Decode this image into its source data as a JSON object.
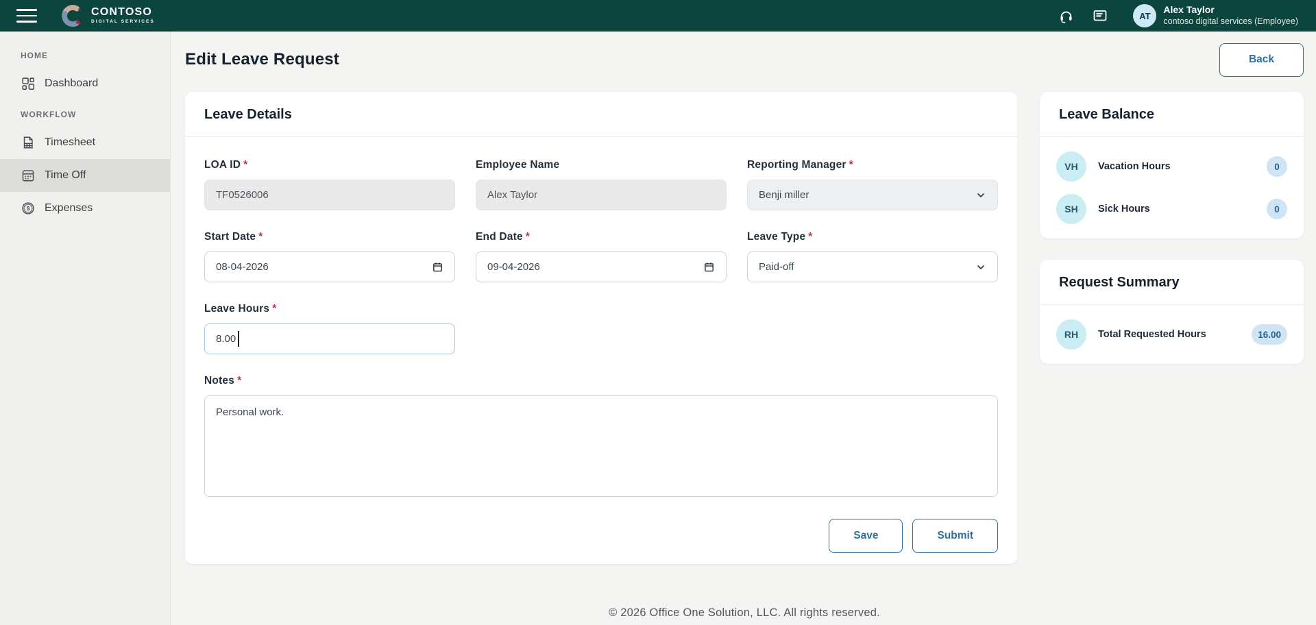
{
  "ui": {
    "required_marker": "*"
  },
  "colors": {
    "header_bg": "#0b453e",
    "accent_blue": "#2e6f9f",
    "required_red": "#b8304a",
    "badge_bg": "#cfe4f4",
    "badge_text": "#28648e",
    "avatar_cyan_bg": "#c9edf3",
    "sidebar_active_bg": "#dcdcda"
  },
  "header": {
    "brand": {
      "name": "CONTOSO",
      "tagline": "DIGITAL SERVICES"
    },
    "user": {
      "initials": "AT",
      "name": "Alex Taylor",
      "org_role": "contoso digital services (Employee)"
    }
  },
  "sidebar": {
    "sections": [
      {
        "label": "HOME",
        "items": [
          {
            "label": "Dashboard"
          }
        ]
      },
      {
        "label": "WORKFLOW",
        "items": [
          {
            "label": "Timesheet"
          },
          {
            "label": "Time Off"
          },
          {
            "label": "Expenses"
          }
        ]
      }
    ]
  },
  "page": {
    "title": "Edit Leave Request",
    "back_label": "Back"
  },
  "form": {
    "section_title": "Leave Details",
    "loa_id": {
      "label": "LOA ID",
      "value": "TF0526006"
    },
    "employee_name": {
      "label": "Employee Name",
      "value": "Alex Taylor"
    },
    "reporting_manager": {
      "label": "Reporting Manager",
      "value": "Benji miller"
    },
    "start_date": {
      "label": "Start Date",
      "value": "08-04-2026"
    },
    "end_date": {
      "label": "End Date",
      "value": "09-04-2026"
    },
    "leave_type": {
      "label": "Leave Type",
      "value": "Paid-off"
    },
    "leave_hours": {
      "label": "Leave Hours",
      "value": "8.00"
    },
    "notes": {
      "label": "Notes",
      "value": "Personal work."
    },
    "actions": {
      "save": "Save",
      "submit": "Submit"
    }
  },
  "leave_balance": {
    "title": "Leave Balance",
    "items": [
      {
        "initials": "VH",
        "label": "Vacation Hours",
        "value": "0"
      },
      {
        "initials": "SH",
        "label": "Sick Hours",
        "value": "0"
      }
    ]
  },
  "request_summary": {
    "title": "Request Summary",
    "items": [
      {
        "initials": "RH",
        "label": "Total Requested Hours",
        "value": "16.00"
      }
    ]
  },
  "footer": {
    "copyright": "© 2026 Office One Solution, LLC. All rights reserved."
  }
}
